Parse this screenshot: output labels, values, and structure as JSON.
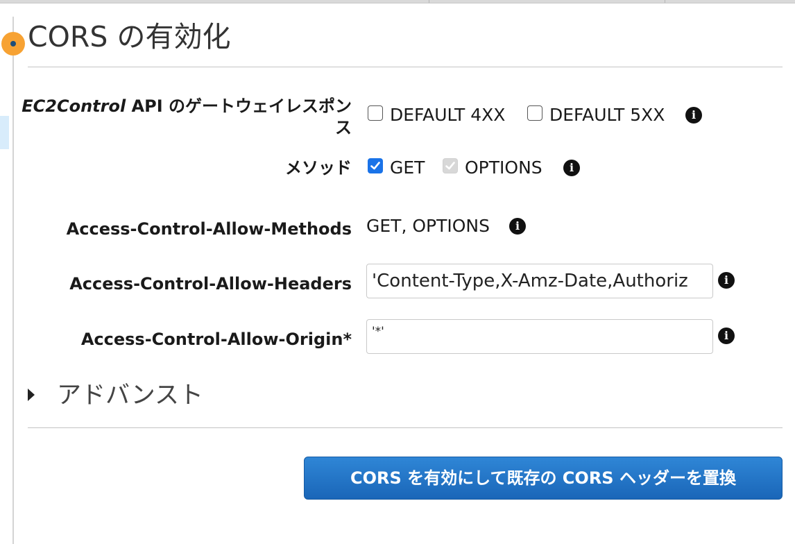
{
  "page": {
    "title": "CORS の有効化"
  },
  "gateway_responses": {
    "label_italic": "EC2Control",
    "label_rest": " API のゲートウェイレスポンス",
    "options": [
      {
        "label": "DEFAULT 4XX",
        "checked": false
      },
      {
        "label": "DEFAULT 5XX",
        "checked": false
      }
    ]
  },
  "methods": {
    "label": "メソッド",
    "options": [
      {
        "label": "GET",
        "checked": true,
        "disabled": false
      },
      {
        "label": "OPTIONS",
        "checked": true,
        "disabled": true
      }
    ]
  },
  "allow_methods": {
    "label": "Access-Control-Allow-Methods",
    "value": "GET, OPTIONS"
  },
  "allow_headers": {
    "label": "Access-Control-Allow-Headers",
    "value": "'Content-Type,X-Amz-Date,Authoriz"
  },
  "allow_origin": {
    "label": "Access-Control-Allow-Origin*",
    "value": "'*'"
  },
  "advanced": {
    "label": "アドバンスト"
  },
  "submit": {
    "label": "CORS を有効にして既存の CORS ヘッダーを置換"
  },
  "icons": {
    "info": "i",
    "info_icon": "info-circle-icon",
    "expand_icon": "caret-right-icon",
    "check_icon": "checkmark-icon"
  },
  "colors": {
    "accent": "#1a73e8",
    "button": "#1f6fc5",
    "status_dot": "#f7a233"
  }
}
